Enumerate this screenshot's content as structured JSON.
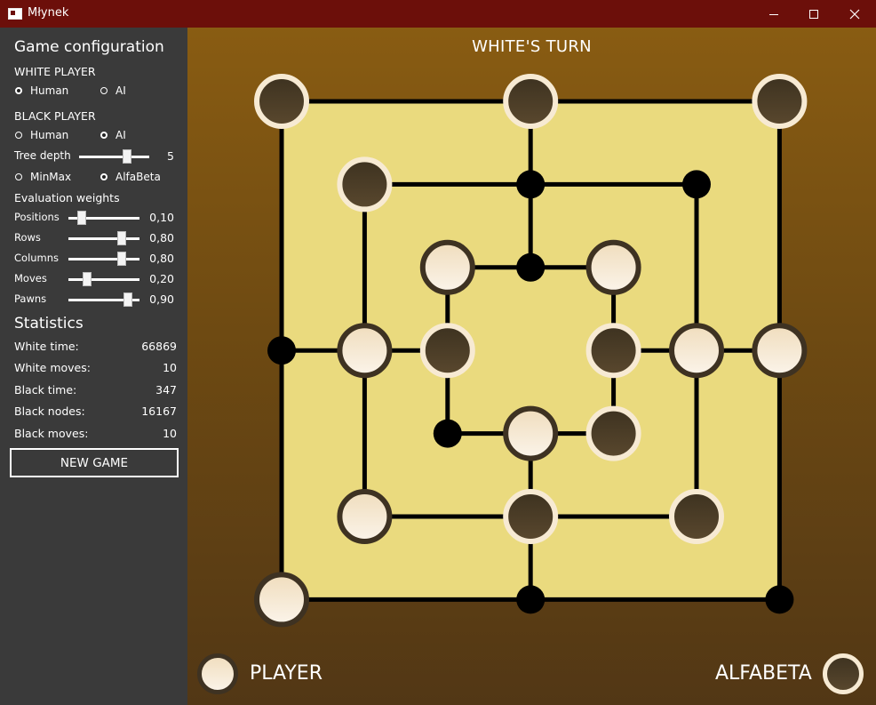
{
  "window": {
    "title": "Młynek"
  },
  "config": {
    "title": "Game configuration",
    "white_player": {
      "label": "WHITE PLAYER",
      "options": [
        "Human",
        "AI"
      ],
      "selected": "Human"
    },
    "black_player": {
      "label": "BLACK PLAYER",
      "options": [
        "Human",
        "AI"
      ],
      "selected": "AI"
    },
    "tree_depth": {
      "label": "Tree depth",
      "value": "5",
      "min": 1,
      "max": 6,
      "level": 5
    },
    "algorithm": {
      "options": [
        "MinMax",
        "AlfaBeta"
      ],
      "selected": "AlfaBeta"
    },
    "weights_title": "Evaluation weights",
    "weights": [
      {
        "label": "Positions",
        "value": "0,10",
        "level": 0.1
      },
      {
        "label": "Rows",
        "value": "0,80",
        "level": 0.8
      },
      {
        "label": "Columns",
        "value": "0,80",
        "level": 0.8
      },
      {
        "label": "Moves",
        "value": "0,20",
        "level": 0.2
      },
      {
        "label": "Pawns",
        "value": "0,90",
        "level": 0.9
      }
    ]
  },
  "statistics": {
    "title": "Statistics",
    "rows": [
      {
        "label": "White time:",
        "value": "66869"
      },
      {
        "label": "White moves:",
        "value": "10"
      },
      {
        "label": "Black time:",
        "value": "347"
      },
      {
        "label": "Black nodes:",
        "value": "16167"
      },
      {
        "label": "Black moves:",
        "value": "10"
      }
    ]
  },
  "new_game_label": "NEW GAME",
  "status": "WHITE'S TURN",
  "players": {
    "white": "PLAYER",
    "black": "ALFABETA"
  },
  "colors": {
    "board": "#eada7e",
    "titlebar": "#6c0f0a",
    "white_piece_fill": "#f3e7d2",
    "black_piece_fill": "#4c3c24"
  },
  "board": {
    "grid": [
      "B--B--B",
      "-B-e-e-",
      "--WeW--",
      "eWB-BWW",
      "--eWB--",
      "-W-B-B-",
      "W--e--e"
    ]
  }
}
